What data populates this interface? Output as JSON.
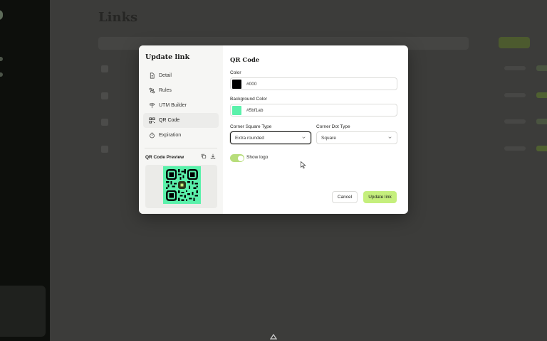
{
  "background": {
    "page_title": "Links"
  },
  "modal": {
    "title": "Update link",
    "nav": [
      {
        "label": "Detail",
        "icon": "document-icon"
      },
      {
        "label": "Rules",
        "icon": "route-icon"
      },
      {
        "label": "UTM Builder",
        "icon": "signpost-icon"
      },
      {
        "label": "QR Code",
        "icon": "qr-code-icon",
        "active": true
      },
      {
        "label": "Expiration",
        "icon": "timer-icon"
      }
    ],
    "preview": {
      "label": "QR Code Preview",
      "qr_background": "#5bf1ab",
      "qr_foreground": "#000"
    },
    "section_title": "QR Code",
    "color": {
      "label": "Color",
      "value": "#000",
      "swatch": "#000000"
    },
    "background_color": {
      "label": "Background Color",
      "value": "#5bf1ab",
      "swatch": "#5bf1ab"
    },
    "corner_square": {
      "label": "Corner Square Type",
      "value": "Extra rounded"
    },
    "corner_dot": {
      "label": "Corner Dot Type",
      "value": "Square"
    },
    "show_logo": {
      "label": "Show logo",
      "enabled": true
    },
    "cancel_label": "Cancel",
    "update_label": "Update link",
    "accent": "#c5ef7d"
  }
}
